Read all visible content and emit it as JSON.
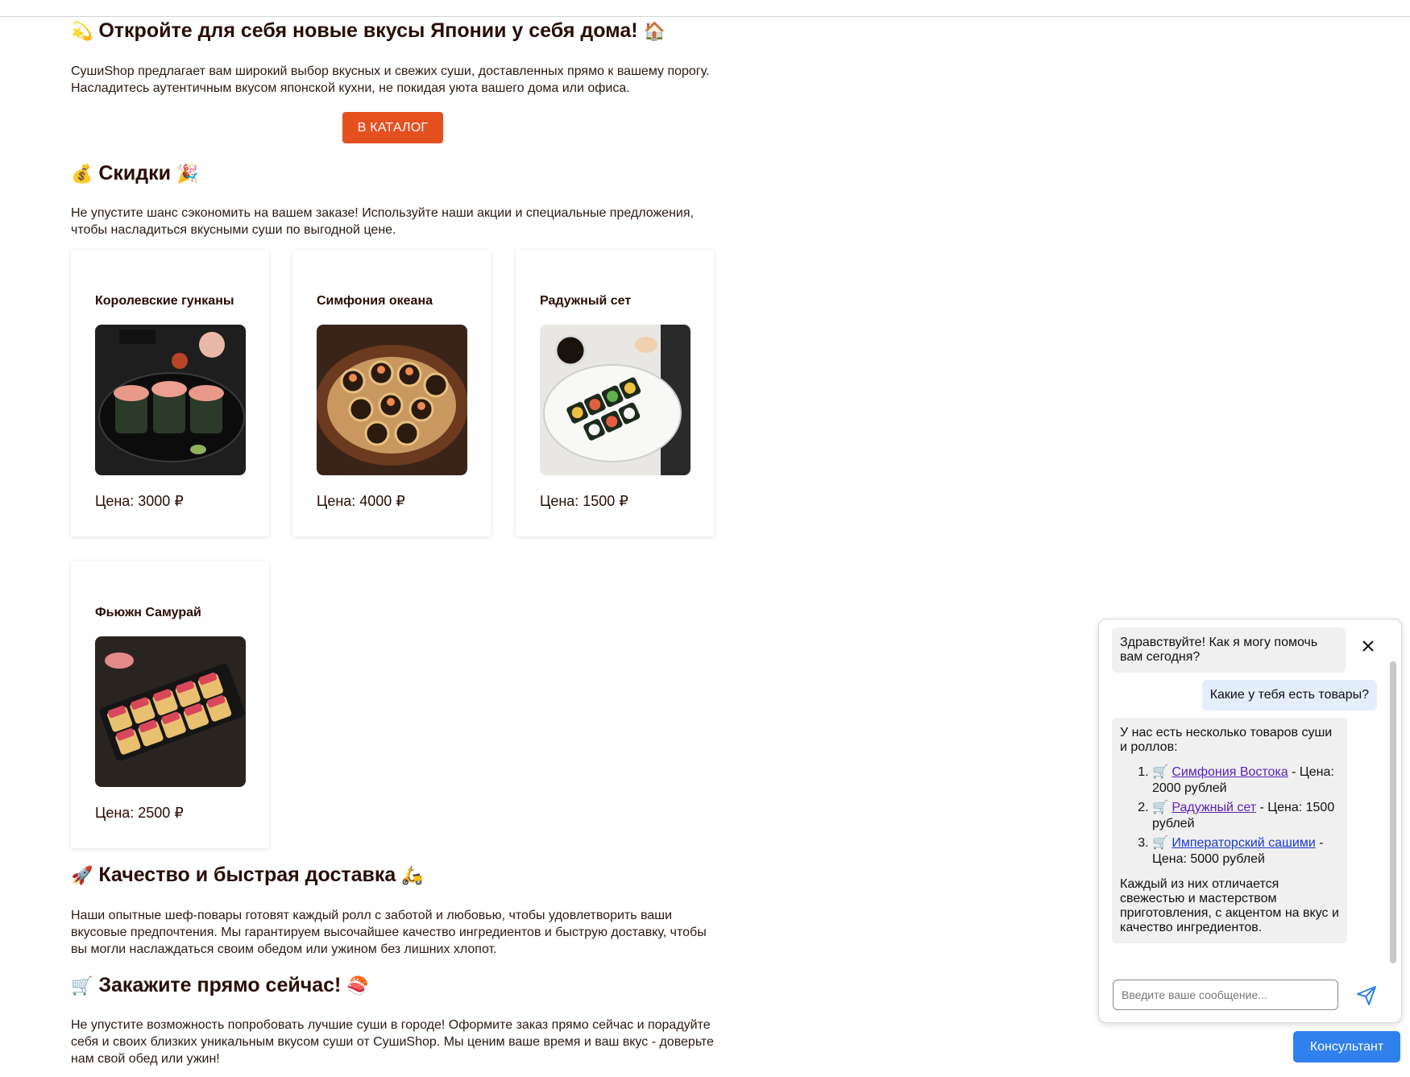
{
  "hero": {
    "emoji_left": "💫",
    "title": "Откройте для себя новые вкусы Японии у себя дома!",
    "emoji_right": "🏠",
    "text": "СушиShop предлагает вам широкий выбор вкусных и свежих суши, доставленных прямо к вашему порогу. Насладитесь аутентичным вкусом японской кухни, не покидая уюта вашего дома или офиса.",
    "button_label": "В КАТАЛОГ"
  },
  "discounts": {
    "emoji_left": "💰",
    "title": "Скидки",
    "emoji_right": "🎉",
    "text": "Не упустите шанс сэкономить на вашем заказе! Используйте наши акции и специальные предложения, чтобы насладиться вкусными суши по выгодной цене."
  },
  "products": [
    {
      "name": "Королевские гунканы",
      "price": "Цена: 3000 ₽"
    },
    {
      "name": "Симфония океана",
      "price": "Цена: 4000 ₽"
    },
    {
      "name": "Радужный сет",
      "price": "Цена: 1500 ₽"
    },
    {
      "name": "Фьюжн Самурай",
      "price": "Цена: 2500 ₽"
    }
  ],
  "quality": {
    "emoji_left": "🚀",
    "title": "Качество и быстрая доставка",
    "emoji_right": "🛵",
    "text": "Наши опытные шеф-повары готовят каждый ролл с заботой и любовью, чтобы удовлетворить ваши вкусовые предпочтения. Мы гарантируем высочайшее качество ингредиентов и быструю доставку, чтобы вы могли наслаждаться своим обедом или ужином без лишних хлопот."
  },
  "order": {
    "emoji_left": "🛒",
    "title": "Закажите прямо сейчас!",
    "emoji_right": "🍣",
    "text": "Не упустите возможность попробовать лучшие суши в городе! Оформите заказ прямо сейчас и порадуйте себя и своих близких уникальным вкусом суши от СушиShop. Мы ценим ваше время и ваш вкус - доверьте нам свой обед или ужин!"
  },
  "chat": {
    "greeting": "Здравствуйте! Как я могу помочь вам сегодня?",
    "user_message": "Какие у тебя есть товары?",
    "reply_intro": "У нас есть несколько товаров суши и роллов:",
    "items": [
      {
        "icon": "🛒",
        "link": "Симфония Востока",
        "rest": " - Цена: 2000 рублей"
      },
      {
        "icon": "🛒",
        "link": "Радужный сет",
        "rest": " - Цена: 1500 рублей"
      },
      {
        "icon": "🛒",
        "link": "Императорский сашими",
        "rest": " - Цена: 5000 рублей"
      }
    ],
    "reply_outro": "Каждый из них отличается свежестью и мастерством приготовления, с акцентом на вкус и качество ингредиентов.",
    "input_placeholder": "Введите ваше сообщение...",
    "consult_button": "Консультант"
  },
  "colors": {
    "accent_orange": "#e5501f",
    "accent_blue": "#2f80ed",
    "heading": "#2a0d05"
  }
}
